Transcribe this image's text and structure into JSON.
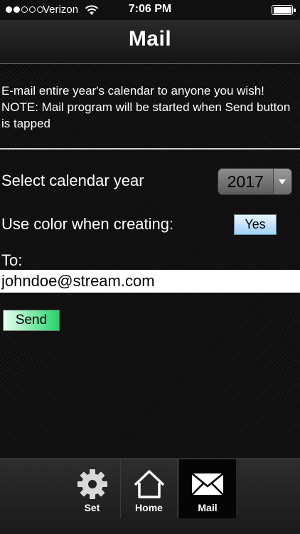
{
  "status": {
    "carrier": "Verizon",
    "time": "7:06 PM",
    "signal_bars": 2,
    "signal_total": 5
  },
  "nav": {
    "title": "Mail"
  },
  "description": "E-mail entire year's calendar to anyone you wish! NOTE: Mail program will be started when Send button is tapped",
  "form": {
    "year_label": "Select calendar year",
    "year_value": "2017",
    "color_label": "Use color when creating:",
    "color_value": "Yes",
    "to_label": "To:",
    "to_value": "johndoe@stream.com",
    "send_label": "Send"
  },
  "tabs": [
    {
      "label": "Set",
      "icon": "gear-icon"
    },
    {
      "label": "Home",
      "icon": "home-icon"
    },
    {
      "label": "Mail",
      "icon": "mail-icon",
      "selected": true
    }
  ],
  "colors": {
    "yes_button": "#9fd3f8",
    "send_button": "#22d66a"
  }
}
